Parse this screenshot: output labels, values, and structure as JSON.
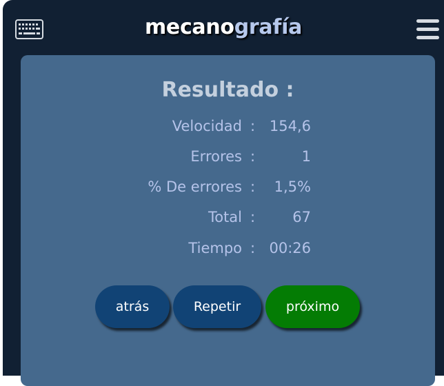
{
  "header": {
    "brand_part1": "mecano",
    "brand_part2": "grafía",
    "left_icon": "keyboard-icon",
    "right_icon": "hamburger-menu-icon"
  },
  "result": {
    "title": "Resultado :",
    "separator": ":",
    "rows": [
      {
        "label": "Velocidad",
        "value": "154,6"
      },
      {
        "label": "Errores",
        "value": "1"
      },
      {
        "label": "% De errores",
        "value": "1,5%"
      },
      {
        "label": "Total",
        "value": "67"
      },
      {
        "label": "Tiempo",
        "value": "00:26"
      }
    ]
  },
  "buttons": {
    "back": "atrás",
    "repeat": "Repetir",
    "next": "próximo"
  },
  "colors": {
    "frame_bg": "#112033",
    "card_bg": "#45698d",
    "text": "#b5c3e9",
    "button_blue": "#114375",
    "button_green": "#047c04"
  }
}
